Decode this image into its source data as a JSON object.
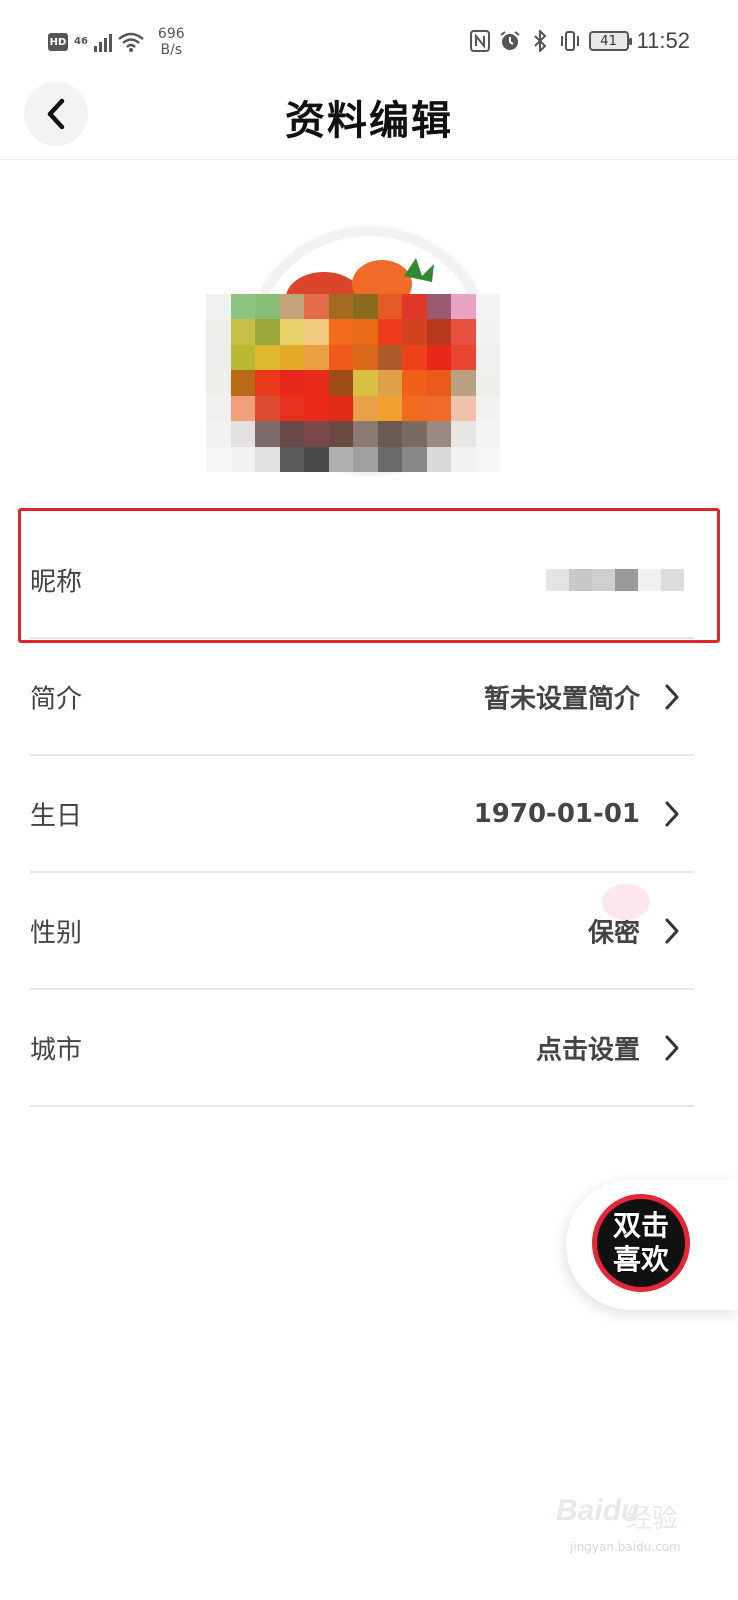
{
  "status_bar": {
    "hd": "HD",
    "network": "46",
    "speed_value": "696",
    "speed_unit": "B/s",
    "battery": "41",
    "time": "11:52",
    "icons": [
      "nfc-icon",
      "alarm-icon",
      "bluetooth-icon",
      "vibrate-icon"
    ]
  },
  "header": {
    "title": "资料编辑",
    "back_icon": "chevron-left-icon"
  },
  "avatar": {
    "redacted": true
  },
  "rows": [
    {
      "label": "昵称",
      "value": ""
    },
    {
      "label": "简介",
      "value": "暂未设置简介"
    },
    {
      "label": "生日",
      "value": "1970-01-01"
    },
    {
      "label": "性别",
      "value": "保密"
    },
    {
      "label": "城市",
      "value": "点击设置"
    }
  ],
  "like_button": {
    "line1": "双击",
    "line2": "喜欢"
  },
  "watermark": {
    "text": "Baidu",
    "cn": "经验",
    "url": "jingyan.baidu.com"
  },
  "colors": {
    "highlight": "#e0252b",
    "like_ring": "#e8263a",
    "text_primary": "#111111",
    "text_secondary": "#444444",
    "divider": "#e6e6e6"
  }
}
